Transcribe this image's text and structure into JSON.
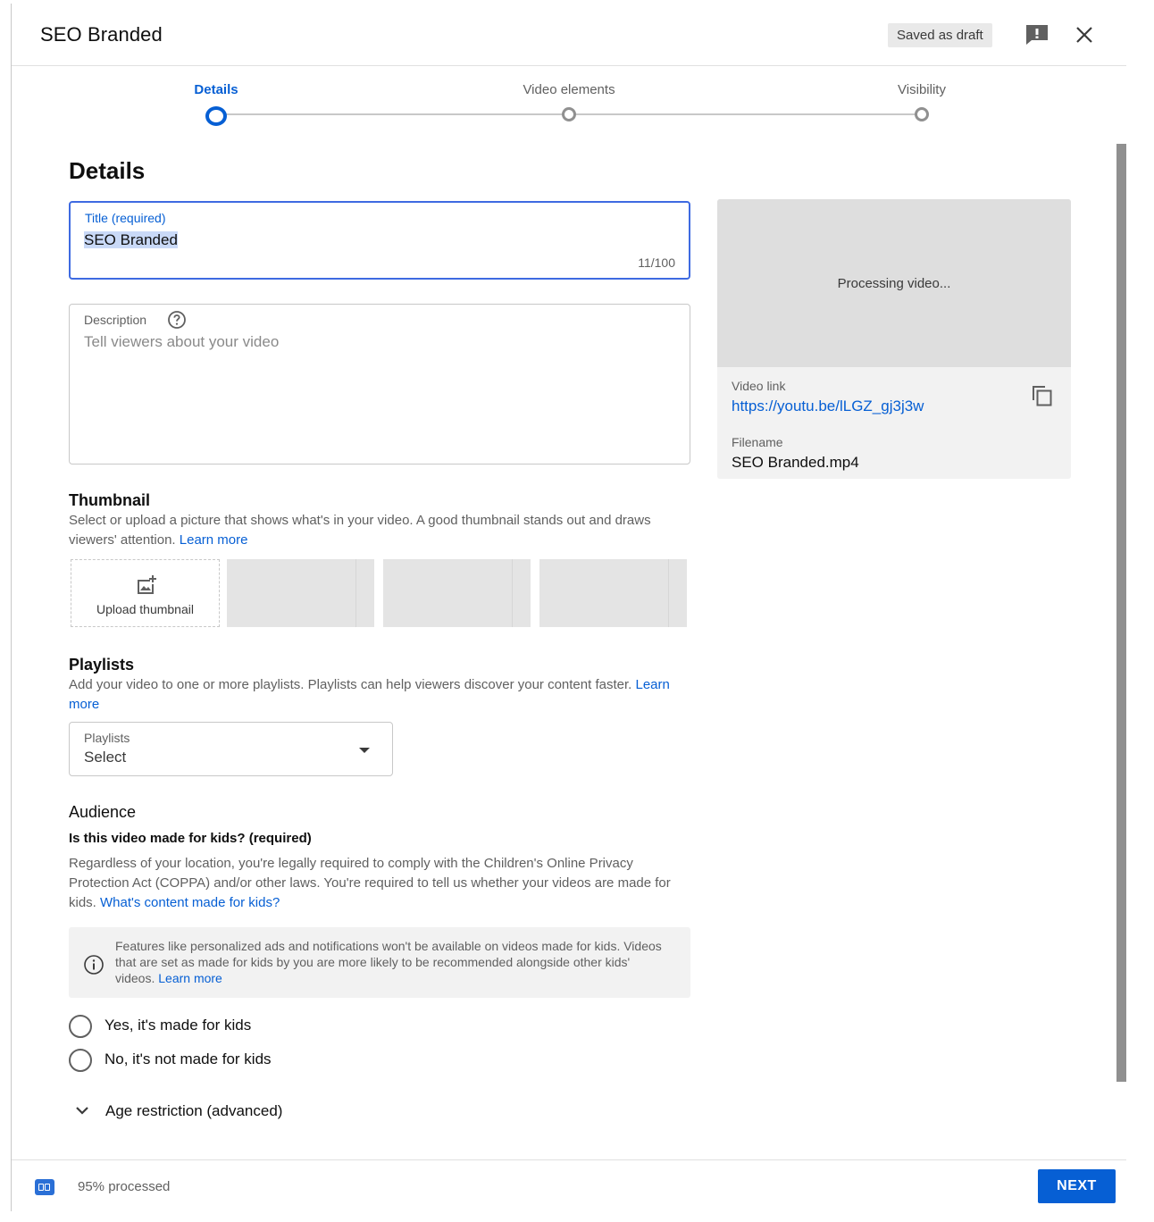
{
  "header": {
    "title": "SEO Branded",
    "draft_status": "Saved as draft"
  },
  "icons": {
    "feedback": "feedback-icon",
    "close": "close-icon",
    "help": "help-icon",
    "copy": "copy-icon",
    "add_photo": "add-photo-icon",
    "dropdown": "caret-down-icon",
    "info": "info-icon",
    "chevron": "chevron-down-icon",
    "hd": "hd-icon"
  },
  "stepper": {
    "steps": [
      {
        "label": "Details",
        "active": true
      },
      {
        "label": "Video elements",
        "active": false
      },
      {
        "label": "Visibility",
        "active": false
      }
    ]
  },
  "details": {
    "heading": "Details",
    "title_field": {
      "label": "Title (required)",
      "value": "SEO Branded",
      "counter": "11/100"
    },
    "description_field": {
      "label": "Description",
      "placeholder": "Tell viewers about your video"
    }
  },
  "preview": {
    "status": "Processing video...",
    "video_link_label": "Video link",
    "video_link": "https://youtu.be/lLGZ_gj3j3w",
    "filename_label": "Filename",
    "filename": "SEO Branded.mp4"
  },
  "thumbnail": {
    "heading": "Thumbnail",
    "description": "Select or upload a picture that shows what's in your video. A good thumbnail stands out and draws viewers' attention.",
    "learn_more": "Learn more",
    "upload_label": "Upload thumbnail"
  },
  "playlists": {
    "heading": "Playlists",
    "description": "Add your video to one or more playlists. Playlists can help viewers discover your content faster.",
    "learn_more": "Learn more",
    "select_label": "Playlists",
    "select_value": "Select"
  },
  "audience": {
    "heading": "Audience",
    "question": "Is this video made for kids? (required)",
    "description": "Regardless of your location, you're legally required to comply with the Children's Online Privacy Protection Act (COPPA) and/or other laws. You're required to tell us whether your videos are made for kids.",
    "description_link": "What's content made for kids?",
    "info": "Features like personalized ads and notifications won't be available on videos made for kids. Videos that are set as made for kids by you are more likely to be recommended alongside other kids' videos.",
    "info_link": "Learn more",
    "option_yes": "Yes, it's made for kids",
    "option_no": "No, it's not made for kids",
    "age_restriction": "Age restriction (advanced)"
  },
  "footer": {
    "processed": "95% processed",
    "next": "NEXT"
  },
  "colors": {
    "accent": "#065fd4",
    "focus_border": "#3e6ae1",
    "text_secondary": "#606060"
  }
}
